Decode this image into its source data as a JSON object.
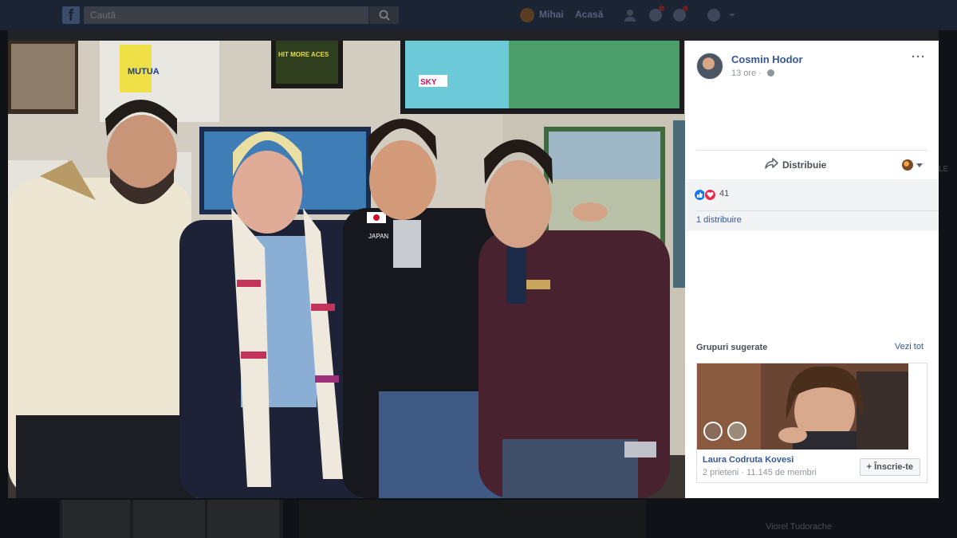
{
  "topbar": {
    "search_placeholder": "Caută",
    "user_name": "Mihai",
    "home_label": "Acasă"
  },
  "post": {
    "author": "Cosmin Hodor",
    "time": "13 ore",
    "time_separator": "·",
    "more_label": "···",
    "share_label": "Distribuie",
    "reaction_count": "41",
    "shares_text": "1 distribuire"
  },
  "photo": {
    "tv_logo": "SKY",
    "poster_text_1": "MUTUA",
    "poster_text_2": "HIT MORE ACES",
    "jacket_text": "JAPAN"
  },
  "suggested_groups": {
    "title": "Grupuri sugerate",
    "see_all": "Vezi tot",
    "group_name": "Laura Codruta Kovesi",
    "group_meta": "2 prieteni · 11.145 de membri",
    "join_label": "+ Înscrie-te"
  },
  "background": {
    "right_name": "Viorel Tudorache",
    "right_col_label": "LE"
  },
  "colors": {
    "link_blue": "#365899",
    "like_blue": "#1877f2",
    "love_red": "#f0284a",
    "topbar": "#1b2433"
  }
}
